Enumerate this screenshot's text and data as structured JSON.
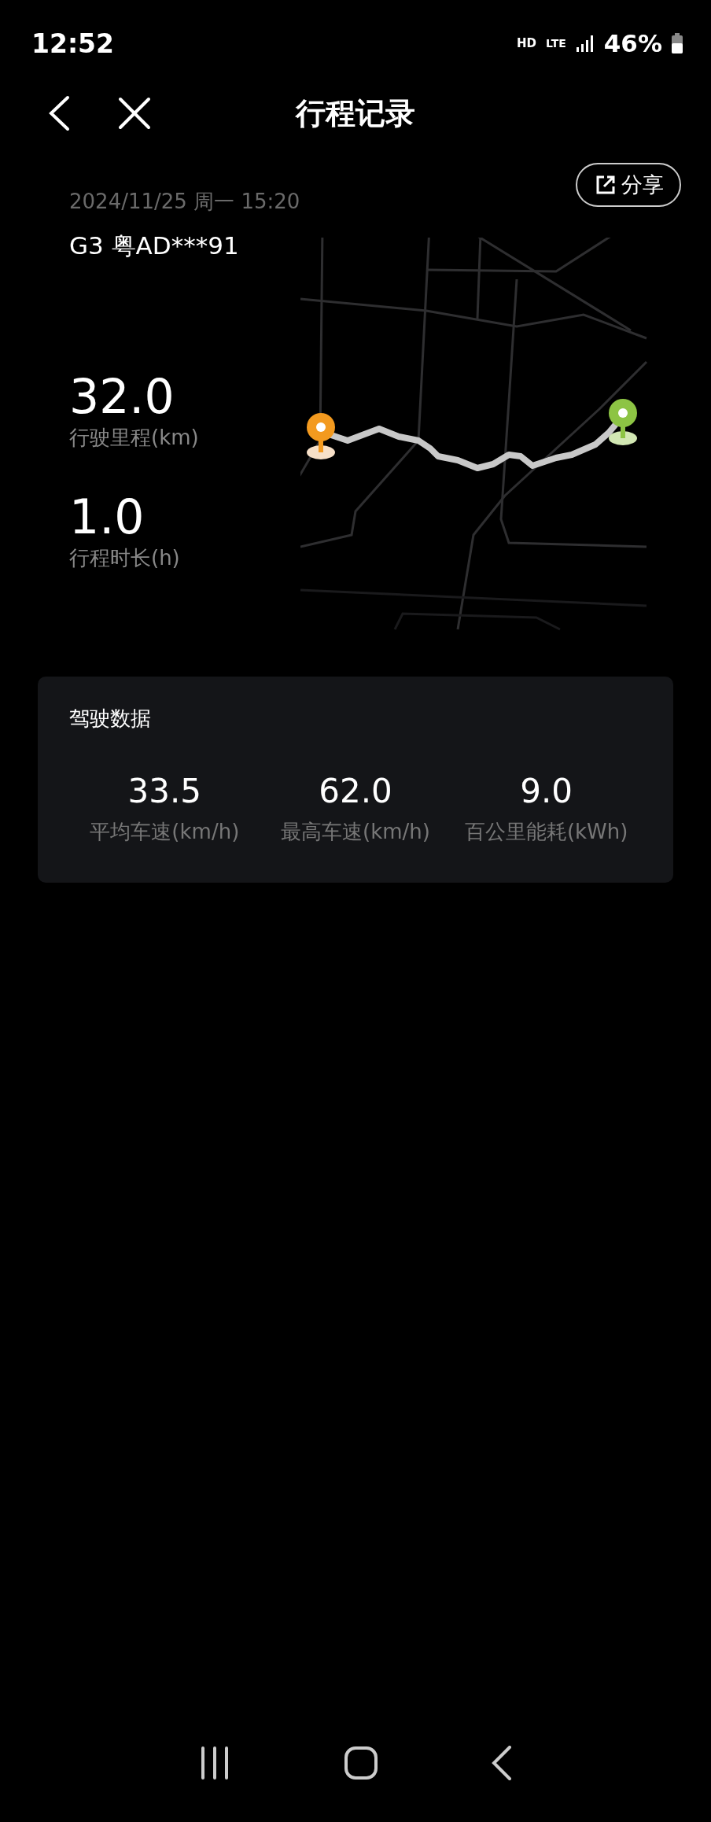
{
  "status_bar": {
    "time": "12:52",
    "network": "HD",
    "signal": "LTE",
    "battery": "46%"
  },
  "header": {
    "title": "行程记录"
  },
  "trip": {
    "datetime": "2024/11/25 周一 15:20",
    "vehicle": "G3 粤AD***91",
    "share_button": "分享",
    "stats": [
      {
        "value": "32.0",
        "label": "行驶里程(km)"
      },
      {
        "value": "1.0",
        "label": "行程时长(h)"
      }
    ]
  },
  "driving_data": {
    "title": "驾驶数据",
    "metrics": [
      {
        "value": "33.5",
        "label": "平均车速(km/h)"
      },
      {
        "value": "62.0",
        "label": "最高车速(km/h)"
      },
      {
        "value": "9.0",
        "label": "百公里能耗(kWh)"
      }
    ]
  }
}
